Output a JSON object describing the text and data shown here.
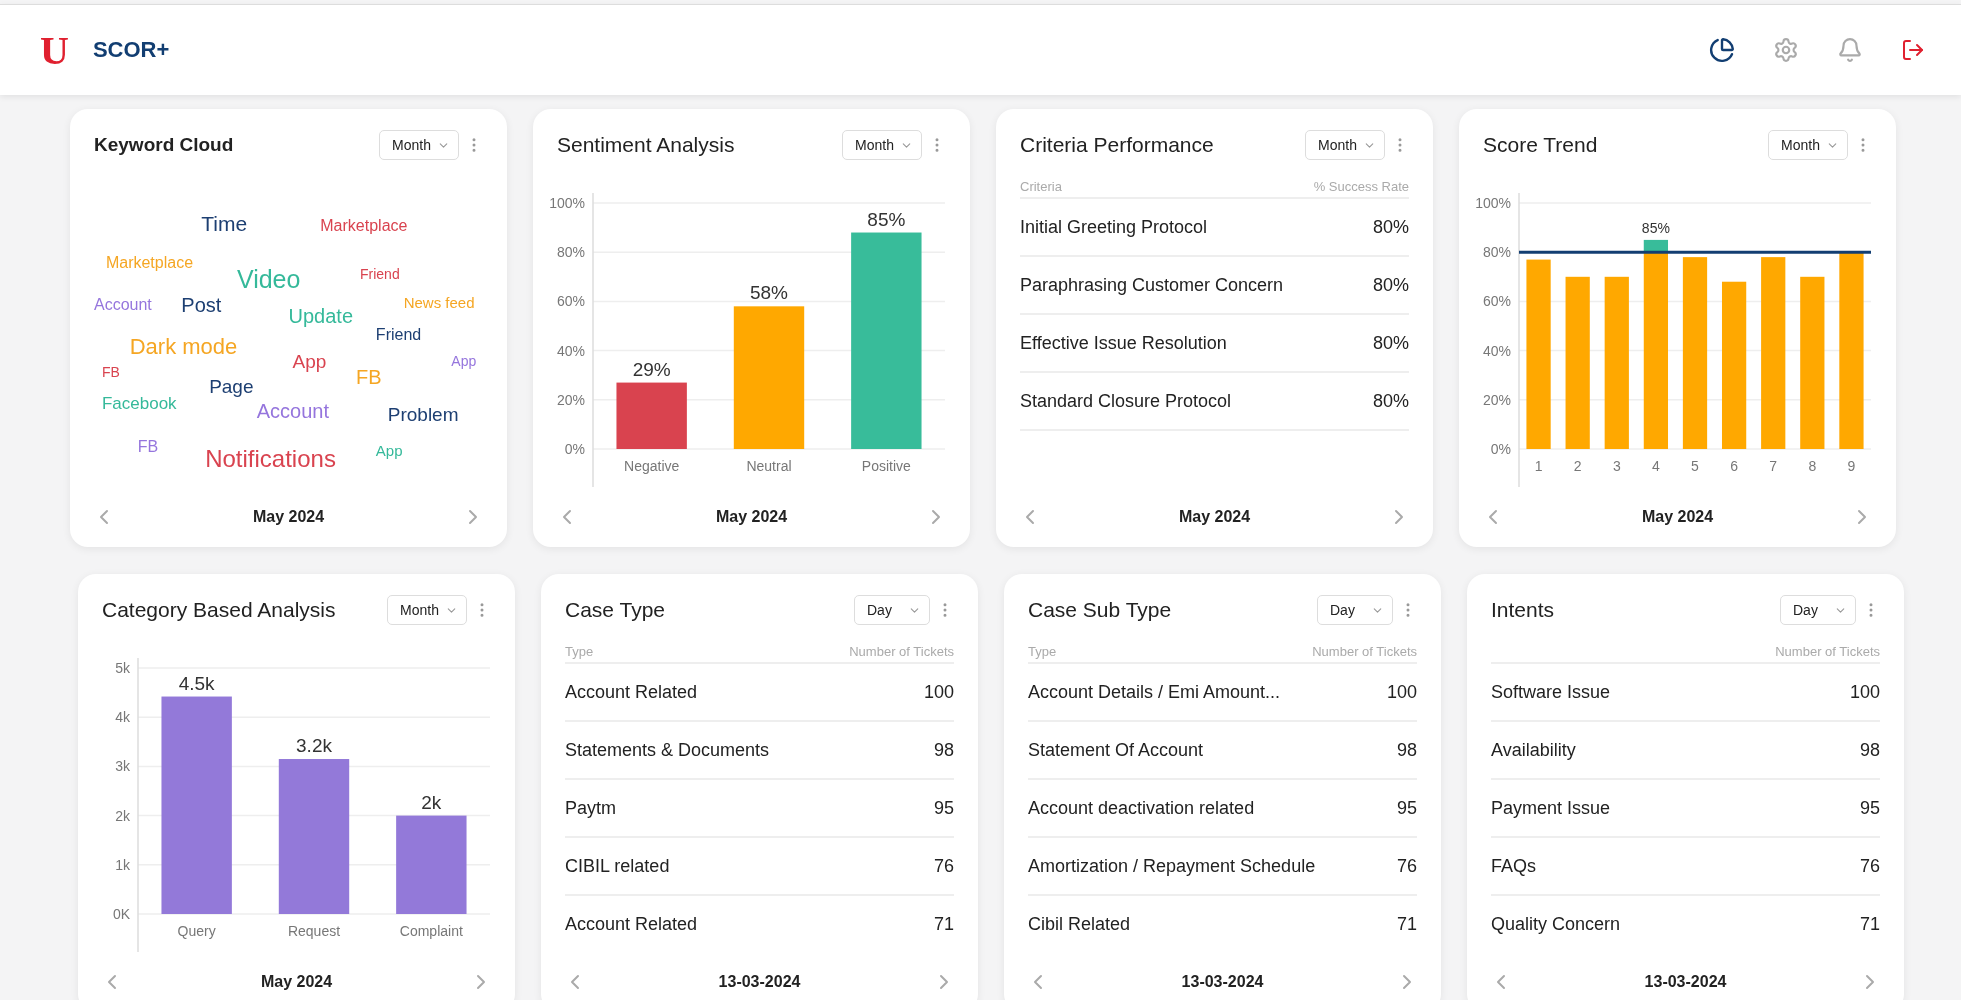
{
  "header": {
    "logo": "U",
    "app_name": "SCOR+"
  },
  "cards": [
    {
      "kind": "cloud",
      "title": "Keyword Cloud",
      "period_filter": "Month",
      "words": [
        {
          "text": "Time",
          "color": "#1d3f72"
        },
        {
          "text": "Marketplace",
          "color": "#d9434f"
        },
        {
          "text": "Marketplace",
          "color": "#f5a623"
        },
        {
          "text": "Video",
          "color": "#35b99a"
        },
        {
          "text": "Friend",
          "color": "#d9434f"
        },
        {
          "text": "Account",
          "color": "#9575dd"
        },
        {
          "text": "Post",
          "color": "#1d3f72"
        },
        {
          "text": "Update",
          "color": "#35b99a"
        },
        {
          "text": "News feed",
          "color": "#f5a623"
        },
        {
          "text": "Dark mode",
          "color": "#f5a623"
        },
        {
          "text": "App",
          "color": "#d9434f"
        },
        {
          "text": "Friend",
          "color": "#1d3f72"
        },
        {
          "text": "App",
          "color": "#9575dd"
        },
        {
          "text": "FB",
          "color": "#d9434f"
        },
        {
          "text": "FB",
          "color": "#f5a623"
        },
        {
          "text": "Page",
          "color": "#1d3f72"
        },
        {
          "text": "Facebook",
          "color": "#35b99a"
        },
        {
          "text": "Account",
          "color": "#9575dd"
        },
        {
          "text": "Problem",
          "color": "#1d3f72"
        },
        {
          "text": "FB",
          "color": "#9575dd"
        },
        {
          "text": "Notifications",
          "color": "#d9434f"
        },
        {
          "text": "App",
          "color": "#35b99a"
        }
      ],
      "footer": "May 2024"
    },
    {
      "kind": "chart",
      "title": "Sentiment Analysis",
      "period_filter": "Month",
      "chart_data": {
        "type": "bar",
        "categories": [
          "Negative",
          "Neutral",
          "Positive"
        ],
        "stacked": true,
        "ylim": [
          0,
          100
        ],
        "yticks": [
          {
            "value": 0,
            "label": "0%"
          },
          {
            "value": 20,
            "label": "20%"
          },
          {
            "value": 40,
            "label": "40%"
          },
          {
            "value": 60,
            "label": "60%"
          },
          {
            "value": 80,
            "label": "80%"
          },
          {
            "value": 100,
            "label": "100%"
          }
        ],
        "grid": true,
        "series": [
          {
            "color": "#d9434f",
            "values": [
              27,
              null,
              null
            ]
          },
          {
            "color": "#ffa800",
            "values": [
              null,
              58,
              null
            ]
          },
          {
            "color": "#38bc9a",
            "values": [
              null,
              null,
              88
            ]
          }
        ],
        "value_labels": [
          "29%",
          "58%",
          "85%"
        ]
      },
      "footer": "May 2024"
    },
    {
      "kind": "table",
      "title": "Criteria Performance",
      "period_filter": "Month",
      "name_header": "Criteria",
      "value_header": "% Success Rate",
      "rows": [
        {
          "name": "Initial Greeting Protocol",
          "value": "80%"
        },
        {
          "name": "Paraphrasing Customer Concern",
          "value": "80%"
        },
        {
          "name": "Effective Issue Resolution",
          "value": "80%"
        },
        {
          "name": "Standard Closure Protocol",
          "value": "80%"
        }
      ],
      "footer": "May 2024"
    },
    {
      "kind": "chart",
      "title": "Score Trend",
      "period_filter": "Month",
      "chart_data": {
        "type": "bar",
        "categories": [
          "1",
          "2",
          "3",
          "4",
          "5",
          "6",
          "7",
          "8",
          "9"
        ],
        "stacked": true,
        "ylim": [
          0,
          100
        ],
        "yticks": [
          {
            "value": 0,
            "label": "0%"
          },
          {
            "value": 20,
            "label": "20%"
          },
          {
            "value": 40,
            "label": "40%"
          },
          {
            "value": 60,
            "label": "60%"
          },
          {
            "value": 80,
            "label": "80%"
          },
          {
            "value": 100,
            "label": "100%"
          }
        ],
        "grid": true,
        "series": [
          {
            "color": "#ffa800",
            "values": [
              77,
              70,
              70,
              80,
              78,
              68,
              78,
              70,
              80
            ]
          },
          {
            "color": "#38bc9a",
            "values": [
              null,
              null,
              null,
              5,
              null,
              null,
              null,
              null,
              null
            ]
          }
        ],
        "value_labels": [
          null,
          null,
          null,
          "85%",
          null,
          null,
          null,
          null,
          null
        ],
        "ref_lines": [
          {
            "axis": "y",
            "value": 80,
            "color": "#123e72"
          }
        ]
      },
      "footer": "May 2024"
    },
    {
      "kind": "chart",
      "title": "Category Based Analysis",
      "period_filter": "Month",
      "chart_data": {
        "type": "bar",
        "categories": [
          "Query",
          "Request",
          "Complaint"
        ],
        "stacked": true,
        "ylim": [
          0,
          5000
        ],
        "yticks": [
          {
            "value": 0,
            "label": "0K"
          },
          {
            "value": 1000,
            "label": "1k"
          },
          {
            "value": 2000,
            "label": "2k"
          },
          {
            "value": 3000,
            "label": "3k"
          },
          {
            "value": 4000,
            "label": "4k"
          },
          {
            "value": 5000,
            "label": "5k"
          }
        ],
        "grid": true,
        "series": [
          {
            "color": "#9379d9",
            "values": [
              4420,
              3150,
              2000
            ]
          }
        ],
        "value_labels": [
          "4.5k",
          "3.2k",
          "2k"
        ]
      },
      "footer": "May 2024"
    },
    {
      "kind": "table",
      "title": "Case Type",
      "period_filter": "Day",
      "name_header": "Type",
      "value_header": "Number of Tickets",
      "rows": [
        {
          "name": "Account Related",
          "value": "100"
        },
        {
          "name": "Statements & Documents",
          "value": "98"
        },
        {
          "name": "Paytm",
          "value": "95"
        },
        {
          "name": "CIBIL related",
          "value": "76"
        },
        {
          "name": "Account Related",
          "value": "71"
        }
      ],
      "footer": "13-03-2024"
    },
    {
      "kind": "table",
      "title": "Case Sub Type",
      "period_filter": "Day",
      "name_header": "Type",
      "value_header": "Number of Tickets",
      "rows": [
        {
          "name": "Account Details / Emi Amount...",
          "value": "100"
        },
        {
          "name": "Statement Of Account",
          "value": "98"
        },
        {
          "name": "Account deactivation related",
          "value": "95"
        },
        {
          "name": "Amortization / Repayment Schedule",
          "value": "76"
        },
        {
          "name": "Cibil Related",
          "value": "71"
        }
      ],
      "footer": "13-03-2024"
    },
    {
      "kind": "table",
      "title": "Intents",
      "period_filter": "Day",
      "value_header": "Number of Tickets",
      "rows": [
        {
          "name": "Software Issue",
          "value": "100"
        },
        {
          "name": "Availability",
          "value": "98"
        },
        {
          "name": "Payment Issue",
          "value": "95"
        },
        {
          "name": "FAQs",
          "value": "76"
        },
        {
          "name": "Quality Concern",
          "value": "71"
        }
      ],
      "footer": "13-03-2024"
    }
  ]
}
